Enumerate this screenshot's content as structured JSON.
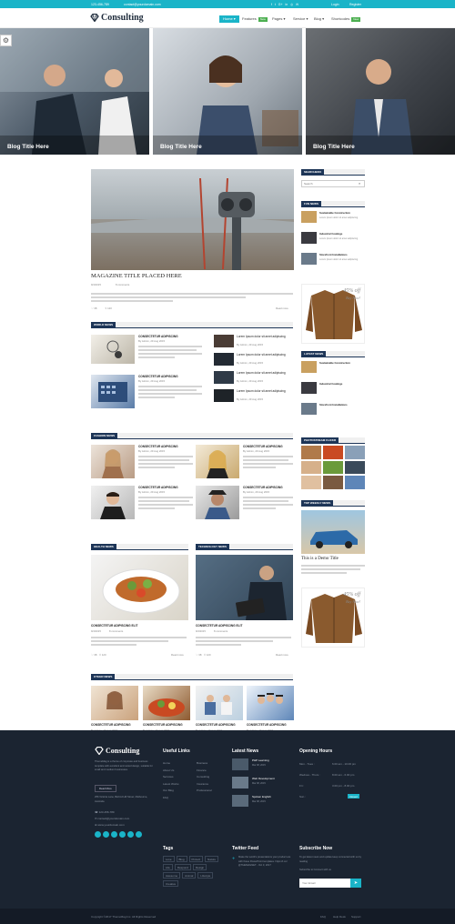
{
  "topbar": {
    "phone": "123-456-789",
    "email": "contact@yourdomain.com",
    "login": "Login",
    "register": "Register"
  },
  "brand": {
    "name": "Consulting"
  },
  "nav": [
    {
      "label": "Home",
      "active": true
    },
    {
      "label": "Features",
      "badge": "New"
    },
    {
      "label": "Pages"
    },
    {
      "label": "Service"
    },
    {
      "label": "Blog"
    },
    {
      "label": "Shortcodes",
      "badge": "New"
    }
  ],
  "hero": [
    {
      "title": "Blog Title Here"
    },
    {
      "title": "Blog Title Here"
    },
    {
      "title": "Blog Title Here"
    }
  ],
  "featured": {
    "title": "MAGAZINE TITLE PLACED HERE",
    "date": "9/4/2015",
    "comments": "8 comments",
    "likes": "38",
    "shares": "120",
    "read_more": "Read more"
  },
  "sections": {
    "world": "WORLD NEWS",
    "fashion": "FASHION NEWS",
    "health": "HEALTH NEWS",
    "technology": "TECHNOLOGY NEWS",
    "other": "OTHER NEWS"
  },
  "article": {
    "title": "CONSECTETUR ADIPISCING",
    "title_elit": "CONSECTETUR ADIPISCING ELIT",
    "by": "By Admin, 29 Aug 2015",
    "small_title": "Lorem Ipsum dolor sit amet adipiscing"
  },
  "sidebar": {
    "search_head": "SEARCHBOX",
    "search_placeholder": "Search",
    "fun_head": "FUN NEWS",
    "latest_head": "LATEST NEWS",
    "flickr_head": "PHOTOSTREAM FLICKR",
    "top_head": "TOP WEEKLY NEWS",
    "items": [
      "Sustainable Construction",
      "Industrial Coatings",
      "Storefront Installations"
    ],
    "ad": {
      "discount": "45% off",
      "cta": "Buy Now!"
    },
    "demo_title": "This is a Demo Title"
  },
  "footer": {
    "brand": "Consulting",
    "about": "ThemeMag is a theme of corporate and business template with excellent and varied design, suitable for small and medium businesses.",
    "read_more": "Read More",
    "address": "256 Victoria Lane, Behind Hill Street, Melbourne, Australia",
    "phone": "123-456-789",
    "email": "contact@yourdomain.com",
    "web": "www.yourdomain.com",
    "useful_head": "Useful Links",
    "links_col1": [
      "Home",
      "About Us",
      "Services",
      "Latest Works",
      "Our Blog",
      "FAQ"
    ],
    "links_col2": [
      "Business",
      "Finance",
      "Consulting",
      "Insurance",
      "Professional"
    ],
    "latest_head": "Latest News",
    "latest": [
      {
        "title": "PHP Learning",
        "date": "Mar 08, 2015"
      },
      {
        "title": "Web Development",
        "date": "Mar 08, 2015"
      },
      {
        "title": "Spoken English",
        "date": "Mar 08, 2015"
      }
    ],
    "hours_head": "Opening Hours",
    "hours": [
      {
        "day": "Mon - Tues :",
        "time": "6.00 am - 10.00 pm"
      },
      {
        "day": "Wednes - Thurs :",
        "time": "8.00 am - 6.00 pm"
      },
      {
        "day": "Fri :",
        "time": "3.00 pm - 8.00 pm"
      },
      {
        "day": "Sun :",
        "time": "Closed"
      }
    ],
    "tags_head": "Tags",
    "tags": [
      "Love",
      "Blog",
      "Protect",
      "Nature",
      "Life",
      "Respond",
      "Design",
      "Awesome",
      "Animal",
      "Lifestyle",
      "Creative"
    ],
    "twitter_head": "Twitter Feed",
    "tweet": "Make the world's presentations your product are with these PowerPoint templates. https://t.co/ @THEMAGNET - Oct 3, 2017",
    "subscribe_head": "Subscribe Now",
    "subscribe_text": "To get latest news and update keep connected with us by reading",
    "subscribe_label": "Subscribe to Connect with us",
    "email_placeholder": "Your Email"
  },
  "copyright": {
    "text": "Copyright ©2017 ThemeMag Inc. All Rights Reserved",
    "links": [
      "FAQ",
      "Help Desk",
      "Support"
    ]
  },
  "colors": {
    "accent": "#1ab4c8",
    "navy": "#1d3557",
    "footer": "#1b2431"
  }
}
